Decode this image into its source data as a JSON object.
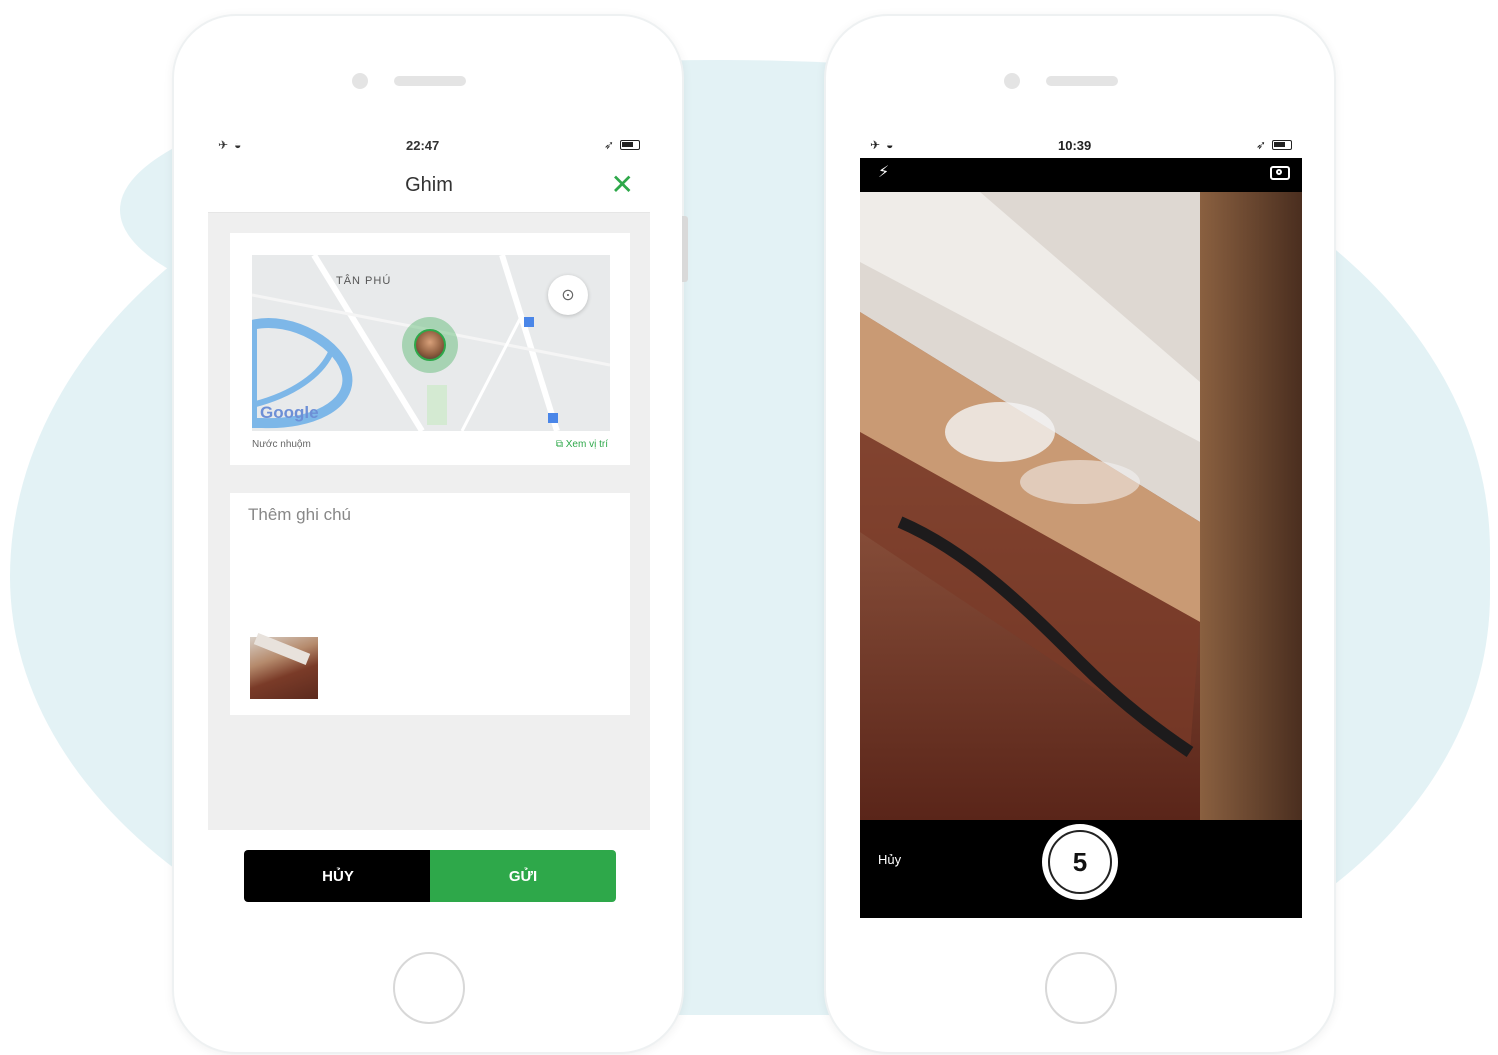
{
  "left_phone": {
    "status": {
      "time": "22:47"
    },
    "header": {
      "title": "Ghim"
    },
    "map": {
      "area_label": "TÂN PHÚ",
      "logo_text": "Google",
      "footer_left": "Nước nhuộm",
      "footer_right": "Xem vị trí"
    },
    "note": {
      "placeholder": "Thêm ghi chú"
    },
    "buttons": {
      "cancel": "HỦY",
      "send": "GỬI"
    }
  },
  "right_phone": {
    "status": {
      "time": "10:39"
    },
    "camera": {
      "cancel_label": "Hủy",
      "countdown": "5"
    }
  },
  "colors": {
    "accent_green": "#2ea84a",
    "background_blob": "#e3f2f5"
  }
}
